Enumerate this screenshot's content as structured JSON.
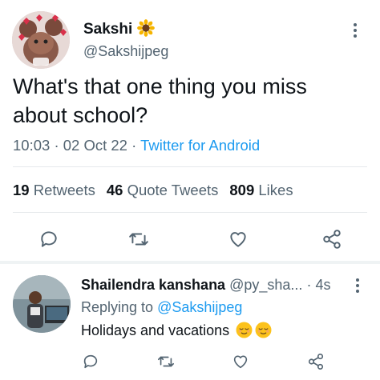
{
  "tweet": {
    "author_name": "Sakshi",
    "author_handle": "@Sakshijpeg",
    "text": "What's that one thing you miss\nabout school?",
    "time": "10:03",
    "date": "02 Oct 22",
    "source": "Twitter for Android",
    "retweets_count": "19",
    "retweets_label": "Retweets",
    "quote_count": "46",
    "quote_label": "Quote Tweets",
    "likes_count": "809",
    "likes_label": "Likes"
  },
  "reply": {
    "author_name": "Shailendra kanshana",
    "author_handle": "@py_sha...",
    "time": "4s",
    "replying_prefix": "Replying to",
    "replying_to": "@Sakshijpeg",
    "text": "Holidays and vacations"
  },
  "icons": {
    "reply": "speech-bubble",
    "retweet": "retweet-arrows",
    "like": "heart-outline",
    "share": "share-nodes",
    "more": "vertical-ellipsis",
    "name_emoji": "sunflower",
    "reply_emoji": "relieved-face"
  },
  "colors": {
    "link": "#1d9bf0",
    "secondary_text": "#536471",
    "primary_text": "#0f1419"
  }
}
